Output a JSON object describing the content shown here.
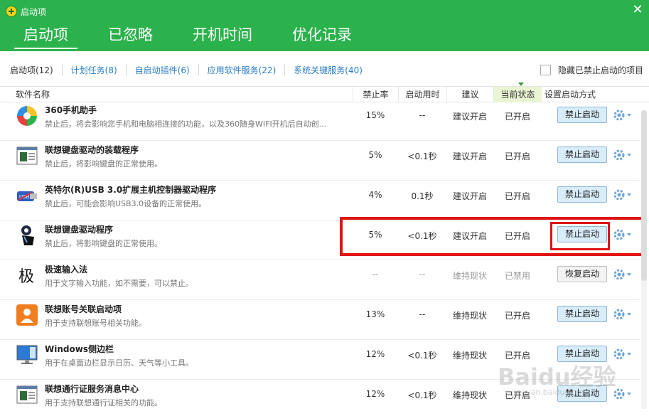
{
  "window": {
    "title": "启动项"
  },
  "main_tabs": [
    {
      "label": "启动项",
      "active": true
    },
    {
      "label": "已忽略",
      "active": false
    },
    {
      "label": "开机时间",
      "active": false
    },
    {
      "label": "优化记录",
      "active": false
    }
  ],
  "sub_tabs": [
    {
      "label": "启动项(12)"
    },
    {
      "label": "计划任务(8)"
    },
    {
      "label": "自启动插件(6)"
    },
    {
      "label": "应用软件服务(22)"
    },
    {
      "label": "系统关键服务(40)"
    }
  ],
  "hide_option": {
    "label": "隐藏已禁止启动的项目",
    "checked": false
  },
  "columns": {
    "name": "软件名称",
    "rate": "禁止率",
    "time": "启动用时",
    "advice": "建议",
    "state": "当前状态",
    "action": "设置启动方式"
  },
  "rows": [
    {
      "icon": "360-helper-icon",
      "title": "360手机助手",
      "desc": "禁止后，将会影响您手机和电脑相连接的功能，以及360随身WIFI开机后自动创...",
      "rate": "15%",
      "time": "--",
      "advice": "建议开启",
      "state": "已开启",
      "button": "禁止启动",
      "disabled": false
    },
    {
      "icon": "installer-window-icon",
      "title": "联想键盘驱动的装载程序",
      "desc": "禁止后，将影响键盘的正常使用。",
      "rate": "5%",
      "time": "<0.1秒",
      "advice": "建议开启",
      "state": "已开启",
      "button": "禁止启动",
      "disabled": false
    },
    {
      "icon": "usb-icon",
      "title": "英特尔(R)USB 3.0扩展主机控制器驱动程序",
      "desc": "禁止后，可能会影响USB3.0设备的正常使用。",
      "rate": "4%",
      "time": "0.1秒",
      "advice": "建议开启",
      "state": "已开启",
      "button": "禁止启动",
      "disabled": false
    },
    {
      "icon": "keyboard-driver-icon",
      "title": "联想键盘驱动程序",
      "desc": "禁止后，将影响键盘的正常使用。",
      "rate": "5%",
      "time": "<0.1秒",
      "advice": "建议开启",
      "state": "已开启",
      "button": "禁止启动",
      "disabled": false
    },
    {
      "icon": "ji-char-icon",
      "title": "极速输入法",
      "desc": "用于文字输入功能，如不需要，可以禁止。",
      "rate": "--",
      "time": "--",
      "advice": "维持现状",
      "state": "已禁用",
      "button": "恢复启动",
      "disabled": true
    },
    {
      "icon": "account-icon",
      "title": "联想账号关联启动项",
      "desc": "用于支持联想账号相关功能。",
      "rate": "13%",
      "time": "--",
      "advice": "维持现状",
      "state": "已开启",
      "button": "禁止启动",
      "disabled": false
    },
    {
      "icon": "sidebar-icon",
      "title": "Windows侧边栏",
      "desc": "用于在桌面边栏显示日历、天气等小工具。",
      "rate": "12%",
      "time": "<0.1秒",
      "advice": "维持现状",
      "state": "已开启",
      "button": "禁止启动",
      "disabled": false
    },
    {
      "icon": "message-center-icon",
      "title": "联想通行证服务消息中心",
      "desc": "用于支持联想通行证相关的功能。",
      "rate": "12%",
      "time": "<0.1秒",
      "advice": "维持现状",
      "state": "已开启",
      "button": "禁止启动",
      "disabled": false
    }
  ],
  "watermark": {
    "text": "Baidu经验",
    "sub": "jingyan.baidu.com"
  },
  "colors": {
    "brand_green": "#2bb24c",
    "highlight_red": "#e01414",
    "link_blue": "#2a7ec6"
  }
}
